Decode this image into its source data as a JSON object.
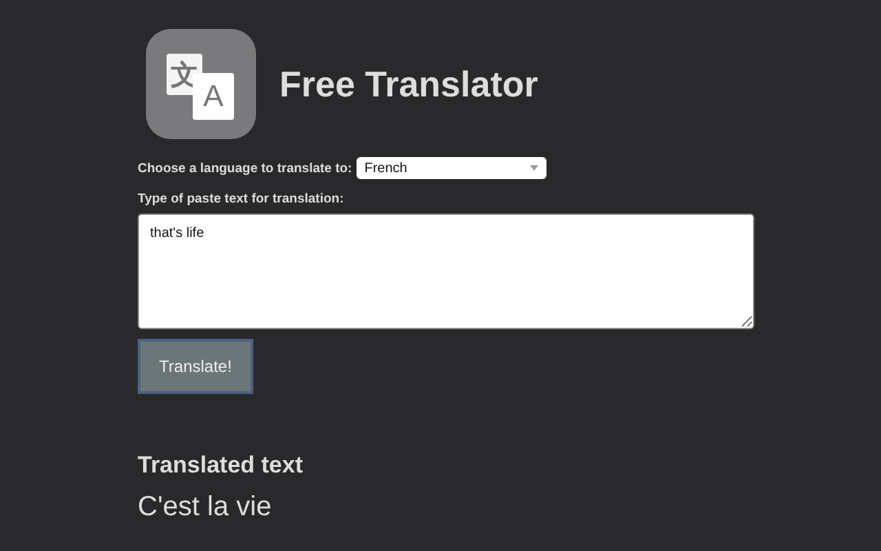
{
  "app": {
    "logo_glyphs": [
      "文",
      "A"
    ],
    "title": "Free Translator"
  },
  "language": {
    "label": "Choose a language to translate to:",
    "value": "French"
  },
  "input": {
    "label": "Type of paste text for translation:",
    "value": "that's life"
  },
  "translate_button": "Translate!",
  "result": {
    "heading": "Translated text",
    "text": "C'est la vie"
  }
}
